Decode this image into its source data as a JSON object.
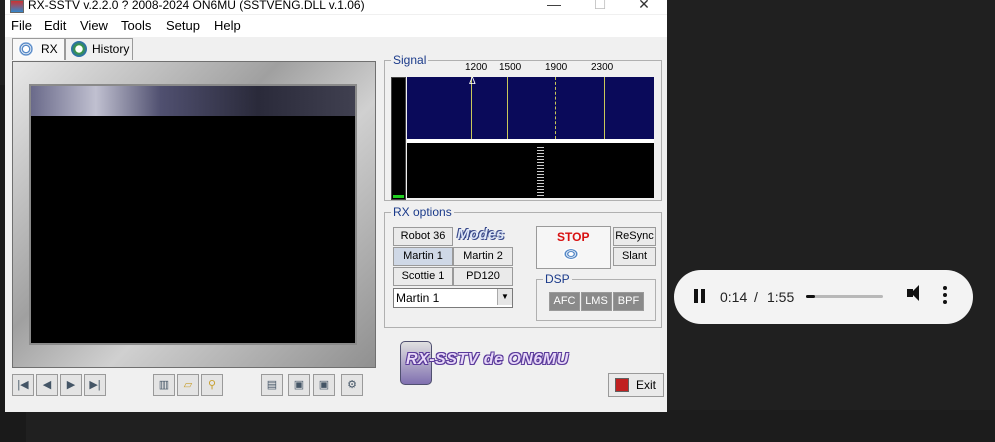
{
  "window": {
    "title": "RX-SSTV v.2.2.0 ? 2008-2024 ON6MU (SSTVENG.DLL v.1.06)",
    "minimize": "—",
    "maximize": "☐",
    "close": "✕"
  },
  "menu": [
    "File",
    "Edit",
    "View",
    "Tools",
    "Setup",
    "Help"
  ],
  "tabs": [
    {
      "label": "RX",
      "icon": "antenna-icon"
    },
    {
      "label": "History",
      "icon": "history-icon"
    }
  ],
  "signal": {
    "group_label": "Signal",
    "ticks": [
      "1200",
      "1500",
      "1900",
      "2300"
    ],
    "marker": "Δ"
  },
  "rx_options": {
    "group_label": "RX options",
    "modes_logo": "Modes",
    "mode_buttons": [
      "Robot 36",
      "Martin 1",
      "Martin 2",
      "Scottie 1",
      "PD120"
    ],
    "mode_select": "Martin 1",
    "stop_label": "STOP",
    "resync_label": "ReSync",
    "slant_label": "Slant",
    "dsp_label": "DSP",
    "dsp_buttons": [
      "AFC",
      "LMS",
      "BPF"
    ]
  },
  "logo_text": "RX-SSTV de ON6MU",
  "exit_label": "Exit",
  "media_player": {
    "current_time": "0:14",
    "separator": "/",
    "total_time": "1:55",
    "progress": 0.12
  },
  "colors": {
    "stop_red": "#d81010",
    "waterfall_blue": "#0a0a5a",
    "frequency_line": "#c8c85a",
    "player_bg": "#f3f3f3"
  }
}
